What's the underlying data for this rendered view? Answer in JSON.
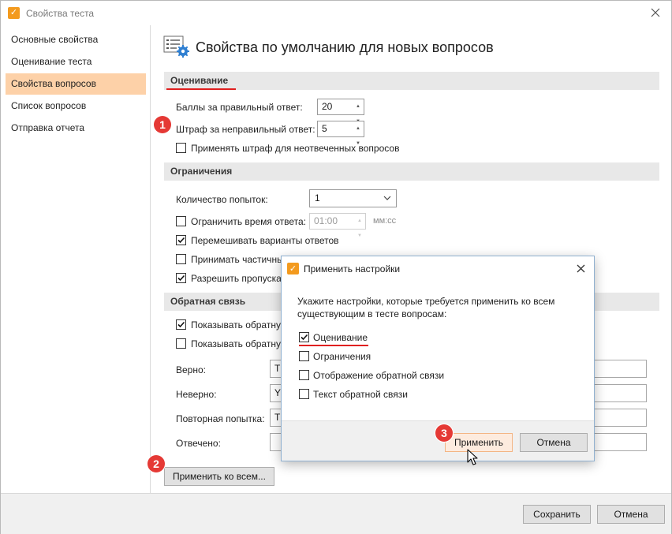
{
  "window": {
    "title": "Свойства теста"
  },
  "sidebar": {
    "items": [
      {
        "label": "Основные свойства"
      },
      {
        "label": "Оценивание теста"
      },
      {
        "label": "Свойства вопросов"
      },
      {
        "label": "Список вопросов"
      },
      {
        "label": "Отправка отчета"
      }
    ],
    "active_index": 2
  },
  "main": {
    "title": "Свойства по умолчанию для новых вопросов",
    "scoring": {
      "header": "Оценивание",
      "correct_label": "Баллы за правильный ответ:",
      "correct_value": "20",
      "penalty_label": "Штраф за неправильный ответ:",
      "penalty_value": "5",
      "apply_penalty_label": "Применять штраф для неотвеченных вопросов"
    },
    "limits": {
      "header": "Ограничения",
      "attempts_label": "Количество попыток:",
      "attempts_value": "1",
      "limit_time_label": "Ограничить время ответа:",
      "time_value": "01:00",
      "time_unit": "мм:сс",
      "shuffle_label": "Перемешивать варианты ответов",
      "partial_label": "Принимать частичные",
      "skip_label": "Разрешить пропуска"
    },
    "feedback": {
      "header": "Обратная связь",
      "show1_label": "Показывать обратну",
      "show2_label": "Показывать обратну",
      "correct_label": "Верно:",
      "correct_value": "Т",
      "incorrect_label": "Неверно:",
      "incorrect_value": "Y",
      "retry_label": "Повторная попытка:",
      "retry_value": "Т",
      "answered_label": "Отвечено:",
      "answered_value": ""
    },
    "apply_all_label": "Применить ко всем..."
  },
  "footer": {
    "save_label": "Сохранить",
    "cancel_label": "Отмена"
  },
  "dialog": {
    "title": "Применить настройки",
    "description_line1": "Укажите настройки, которые требуется применить ко всем",
    "description_line2": "существующим в тесте вопросам:",
    "options": [
      {
        "label": "Оценивание",
        "checked": true
      },
      {
        "label": "Ограничения",
        "checked": false
      },
      {
        "label": "Отображение обратной связи",
        "checked": false
      },
      {
        "label": "Текст обратной связи",
        "checked": false
      }
    ],
    "apply_label": "Применить",
    "cancel_label": "Отмена"
  },
  "badges": [
    "1",
    "2",
    "3"
  ],
  "colors": {
    "accent_orange": "#f39a1e",
    "active_item_bg": "#fdd1a8",
    "badge_red": "#e53935",
    "underline_red": "#e02020",
    "primary_button_bg": "#fdebde"
  },
  "icons": {
    "app": "checkmark-app-icon",
    "close": "close-icon",
    "header": "list-settings-icon",
    "chevron": "chevron-down-icon",
    "cursor": "mouse-pointer-icon"
  }
}
